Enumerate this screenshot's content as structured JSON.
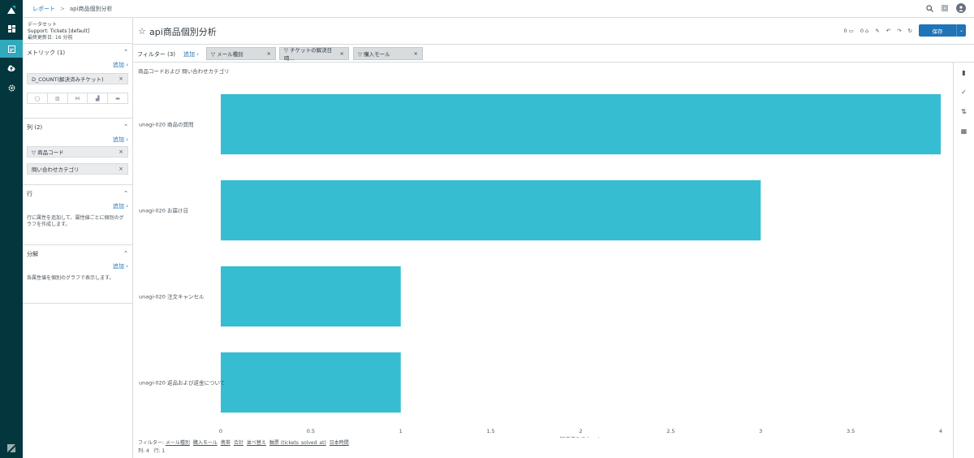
{
  "breadcrumb": {
    "parent": "レポート",
    "separator": ">",
    "current": "api商品個別分析"
  },
  "dataset": {
    "label": "データセット",
    "name": "Support: Tickets [default]",
    "updated": "最終更新日: 16 分前"
  },
  "panel": {
    "metrics": {
      "title": "メトリック (1)",
      "add": "追加 ›",
      "items": [
        {
          "label": "D_COUNT(解決済みチケット)"
        }
      ]
    },
    "columns": {
      "title": "列 (2)",
      "add": "追加 ›",
      "items": [
        {
          "label": "商品コード"
        },
        {
          "label": "問い合わせカテゴリ"
        }
      ]
    },
    "rows": {
      "title": "行",
      "add": "追加 ›",
      "hint": "行に属性を追加して、属性値ごとに個別のグラフを作成します。"
    },
    "breakdown": {
      "title": "分解",
      "add": "追加 ›",
      "hint": "各属性値を個別のグラフで表示します。"
    }
  },
  "report": {
    "title": "api商品個別分析",
    "save_label": "保存",
    "counter_a": "0",
    "counter_b": "0"
  },
  "filters": {
    "label": "フィルター (3)",
    "add": "追加 ›",
    "items": [
      {
        "label": "メール種別"
      },
      {
        "label": "チケットの解決日時..."
      },
      {
        "label": "購入モール"
      }
    ]
  },
  "chart_data": {
    "type": "bar",
    "orientation": "horizontal",
    "title": "商品コードおよび 問い合わせカテゴリ",
    "categories": [
      "unagi-020 商品の質問",
      "unagi-020 お届け日",
      "unagi-020 注文キャンセル",
      "unagi-020 返品および返金について"
    ],
    "values": [
      4,
      3,
      1,
      1
    ],
    "xlabel": "解決済みチケット",
    "ylabel": "",
    "xlim": [
      0,
      4
    ],
    "xticks": [
      "0",
      "0.5",
      "1",
      "1.5",
      "2",
      "2.5",
      "3",
      "3.5",
      "4"
    ],
    "color": "#37bdd2",
    "grid": false,
    "legend": "none"
  },
  "footer": {
    "filters_label": "フィルター:",
    "filters": [
      "メール種別",
      "購入モール",
      "携帯",
      "合計",
      "並べ替え",
      "軸票 (tickets_solved_at)",
      "日本時間"
    ],
    "cols": "列: 4",
    "rows": "行: 1"
  }
}
